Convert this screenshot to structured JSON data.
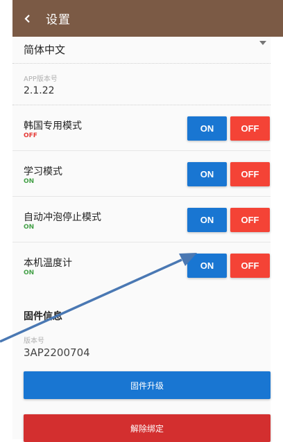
{
  "appbar": {
    "title": "设置",
    "back_icon": "chevron-left-icon"
  },
  "language": {
    "value": "简体中文"
  },
  "app_version": {
    "label": "APP版本号",
    "value": "2.1.22"
  },
  "modes": [
    {
      "title": "韩国专用模式",
      "status": "OFF",
      "on_label": "ON",
      "off_label": "OFF"
    },
    {
      "title": "学习模式",
      "status": "ON",
      "on_label": "ON",
      "off_label": "OFF"
    },
    {
      "title": "自动冲泡停止模式",
      "status": "ON",
      "on_label": "ON",
      "off_label": "OFF"
    },
    {
      "title": "本机温度计",
      "status": "ON",
      "on_label": "ON",
      "off_label": "OFF"
    }
  ],
  "firmware": {
    "section_title": "固件信息",
    "version_label": "版本号",
    "version_value": "3AP2200704",
    "upgrade_label": "固件升级",
    "unbind_label": "解除绑定"
  },
  "colors": {
    "appbar": "#7b5a45",
    "on_button": "#1976d2",
    "off_button": "#f44336",
    "status_off": "#e53935",
    "status_on": "#43a047",
    "annotation_arrow": "#4a78b3"
  }
}
